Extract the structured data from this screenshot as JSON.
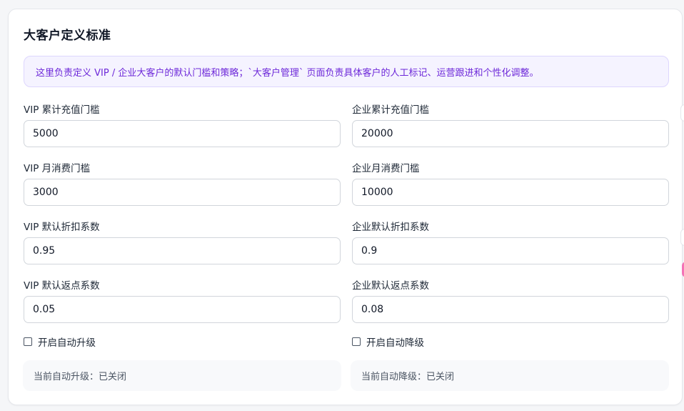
{
  "card": {
    "title": "大客户定义标准",
    "notice": "这里负责定义 VIP / 企业大客户的默认门槛和策略；`大客户管理` 页面负责具体客户的人工标记、运营跟进和个性化调整。"
  },
  "fields": {
    "vip_recharge": {
      "label": "VIP 累计充值门槛",
      "value": "5000"
    },
    "ent_recharge": {
      "label": "企业累计充值门槛",
      "value": "20000"
    },
    "vip_monthly": {
      "label": "VIP 月消费门槛",
      "value": "3000"
    },
    "ent_monthly": {
      "label": "企业月消费门槛",
      "value": "10000"
    },
    "vip_discount": {
      "label": "VIP 默认折扣系数",
      "value": "0.95"
    },
    "ent_discount": {
      "label": "企业默认折扣系数",
      "value": "0.9"
    },
    "vip_rebate": {
      "label": "VIP 默认返点系数",
      "value": "0.05"
    },
    "ent_rebate": {
      "label": "企业默认返点系数",
      "value": "0.08"
    }
  },
  "toggles": {
    "auto_upgrade": {
      "label": "开启自动升级",
      "checked": false
    },
    "auto_downgrade": {
      "label": "开启自动降级",
      "checked": false
    }
  },
  "status": {
    "upgrade": "当前自动升级：已关闭",
    "downgrade": "当前自动降级：已关闭"
  },
  "colors": {
    "accent": "#6d28d9",
    "notice_bg": "#f5f3ff",
    "notice_border": "#ddd6fe",
    "side_indicator": "#f472b6"
  }
}
